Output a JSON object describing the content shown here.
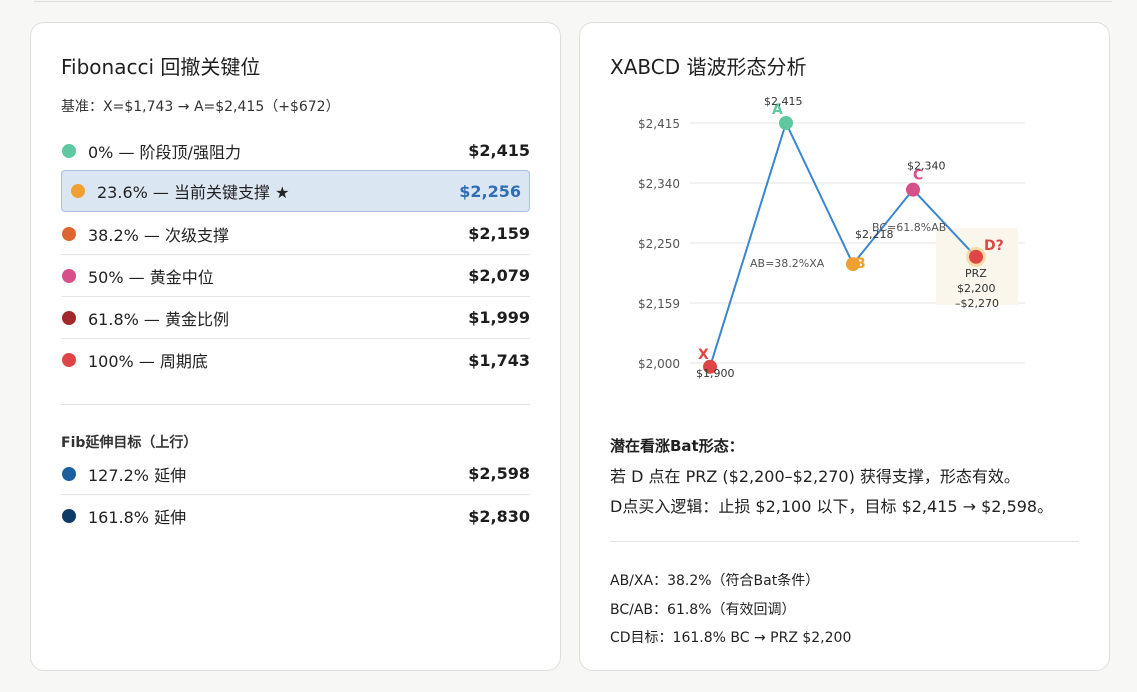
{
  "fibonacci": {
    "title": "Fibonacci 回撤关键位",
    "baseline": "基准：X=$1,743 → A=$2,415（+$672）",
    "levels": [
      {
        "label": "0% — 阶段顶/强阻力",
        "value": "$2,415",
        "color": "#5ec8a0"
      },
      {
        "label": "23.6% — 当前关键支撑 ★",
        "value": "$2,256",
        "color": "#f0a030"
      },
      {
        "label": "38.2% — 次级支撑",
        "value": "$2,159",
        "color": "#dd6630"
      },
      {
        "label": "50% — 黄金中位",
        "value": "$2,079",
        "color": "#d6508a"
      },
      {
        "label": "61.8% — 黄金比例",
        "value": "$1,999",
        "color": "#a02a2a"
      },
      {
        "label": "100% — 周期底",
        "value": "$1,743",
        "color": "#e04545"
      }
    ],
    "extension_title": "Fib延伸目标（上行）",
    "extensions": [
      {
        "label": "127.2% 延伸",
        "value": "$2,598",
        "color": "#1c5f9f"
      },
      {
        "label": "161.8% 延伸",
        "value": "$2,830",
        "color": "#0f3b6a"
      }
    ]
  },
  "xabcd": {
    "title": "XABCD 谐波形态分析",
    "analysis_title": "潜在看涨Bat形态：",
    "analysis_lines": [
      "若 D 点在 PRZ ($2,200–$2,270) 获得支撑，形态有效。",
      "D点买入逻辑：止损 $2,100 以下，目标 $2,415 → $2,598。"
    ],
    "metrics": [
      "AB/XA：38.2%（符合Bat条件）",
      "BC/AB：61.8%（有效回调）",
      "CD目标：161.8% BC → PRZ $2,200"
    ]
  },
  "chart_data": {
    "type": "line",
    "y_ticks": [
      "$2,415",
      "$2,340",
      "$2,250",
      "$2,159",
      "$2,000"
    ],
    "points": [
      {
        "name": "X",
        "price": 1990,
        "label": "$1,900",
        "color": "#e04545"
      },
      {
        "name": "A",
        "price": 2415,
        "label": "$2,415",
        "color": "#5ec8a0"
      },
      {
        "name": "B",
        "price": 2218,
        "label": "$2,218",
        "color": "#f0a030"
      },
      {
        "name": "C",
        "price": 2330,
        "label": "$2,340",
        "color": "#d6508a"
      },
      {
        "name": "D?",
        "price": 2229,
        "label": "",
        "color": "#e04545"
      }
    ],
    "annotations": {
      "ab": "AB=38.2%XA",
      "bc": "BC=61.8%AB",
      "prz_title": "PRZ",
      "prz_range": "$2,200\n–$2,270"
    },
    "line_color": "#3a87d0"
  }
}
